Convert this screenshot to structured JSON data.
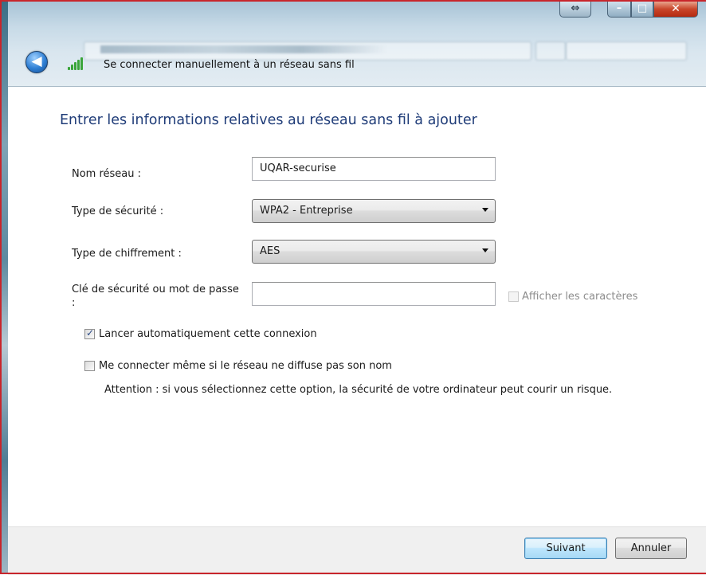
{
  "window": {
    "title": "Se connecter manuellement à un réseau sans fil",
    "controls": {
      "resize_glyph": "⇔",
      "minimize_glyph": "–",
      "maximize_glyph": "□",
      "close_glyph": "✕"
    }
  },
  "nav": {
    "back_glyph": "◀"
  },
  "form": {
    "heading": "Entrer les informations relatives au réseau sans fil à ajouter",
    "network_name": {
      "label": "Nom réseau :",
      "value": "UQAR-securise"
    },
    "security_type": {
      "label": "Type de sécurité :",
      "value": "WPA2 - Entreprise"
    },
    "encryption_type": {
      "label": "Type de chiffrement :",
      "value": "AES"
    },
    "security_key": {
      "label": "Clé de sécurité ou mot de passe :",
      "value": ""
    },
    "show_characters": {
      "label": "Afficher les caractères",
      "checked": false,
      "enabled": false
    },
    "auto_start": {
      "label": "Lancer automatiquement cette connexion",
      "checked": true
    },
    "connect_hidden": {
      "label": "Me connecter même si le réseau ne diffuse pas son nom",
      "checked": false
    },
    "warning": "Attention : si vous sélectionnez cette option, la sécurité de votre ordinateur peut courir un risque."
  },
  "buttons": {
    "next": "Suivant",
    "cancel": "Annuler"
  },
  "colors": {
    "heading": "#1f3c78",
    "frame": "#c8252b",
    "signal": "#3aa53a"
  }
}
